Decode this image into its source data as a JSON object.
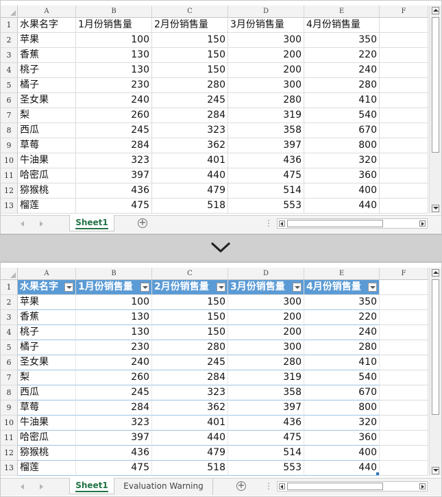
{
  "columns": [
    "A",
    "B",
    "C",
    "D",
    "E",
    "F"
  ],
  "headers": [
    "水果名字",
    "1月份销售量",
    "2月份销售量",
    "3月份销售量",
    "4月份销售量"
  ],
  "rows": [
    {
      "n": "2",
      "name": "苹果",
      "v": [
        "100",
        "150",
        "300",
        "350"
      ]
    },
    {
      "n": "3",
      "name": "香蕉",
      "v": [
        "130",
        "150",
        "200",
        "220"
      ]
    },
    {
      "n": "4",
      "name": "桃子",
      "v": [
        "130",
        "150",
        "200",
        "240"
      ]
    },
    {
      "n": "5",
      "name": "橘子",
      "v": [
        "230",
        "280",
        "300",
        "280"
      ]
    },
    {
      "n": "6",
      "name": "圣女果",
      "v": [
        "240",
        "245",
        "280",
        "410"
      ]
    },
    {
      "n": "7",
      "name": "梨",
      "v": [
        "260",
        "284",
        "319",
        "540"
      ]
    },
    {
      "n": "8",
      "name": "西瓜",
      "v": [
        "245",
        "323",
        "358",
        "670"
      ]
    },
    {
      "n": "9",
      "name": "草莓",
      "v": [
        "284",
        "362",
        "397",
        "800"
      ]
    },
    {
      "n": "10",
      "name": "牛油果",
      "v": [
        "323",
        "401",
        "436",
        "320"
      ]
    },
    {
      "n": "11",
      "name": "哈密瓜",
      "v": [
        "397",
        "440",
        "475",
        "360"
      ]
    },
    {
      "n": "12",
      "name": "猕猴桃",
      "v": [
        "436",
        "479",
        "514",
        "400"
      ]
    },
    {
      "n": "13",
      "name": "榴莲",
      "v": [
        "475",
        "518",
        "553",
        "440"
      ]
    }
  ],
  "header_row_number": "1",
  "top_panel": {
    "tabs": [
      "Sheet1"
    ]
  },
  "bottom_panel": {
    "tabs": [
      "Sheet1",
      "Evaluation Warning"
    ]
  },
  "icons": {
    "separator": "chevron-down-icon",
    "add_sheet": "plus-circle-icon",
    "filter": "dropdown-filter-icon"
  },
  "colors": {
    "table_header": "#5b9bd5",
    "table_row_line": "#9dc3e6",
    "active_tab": "#217346",
    "separator": "#d0d0d0"
  }
}
